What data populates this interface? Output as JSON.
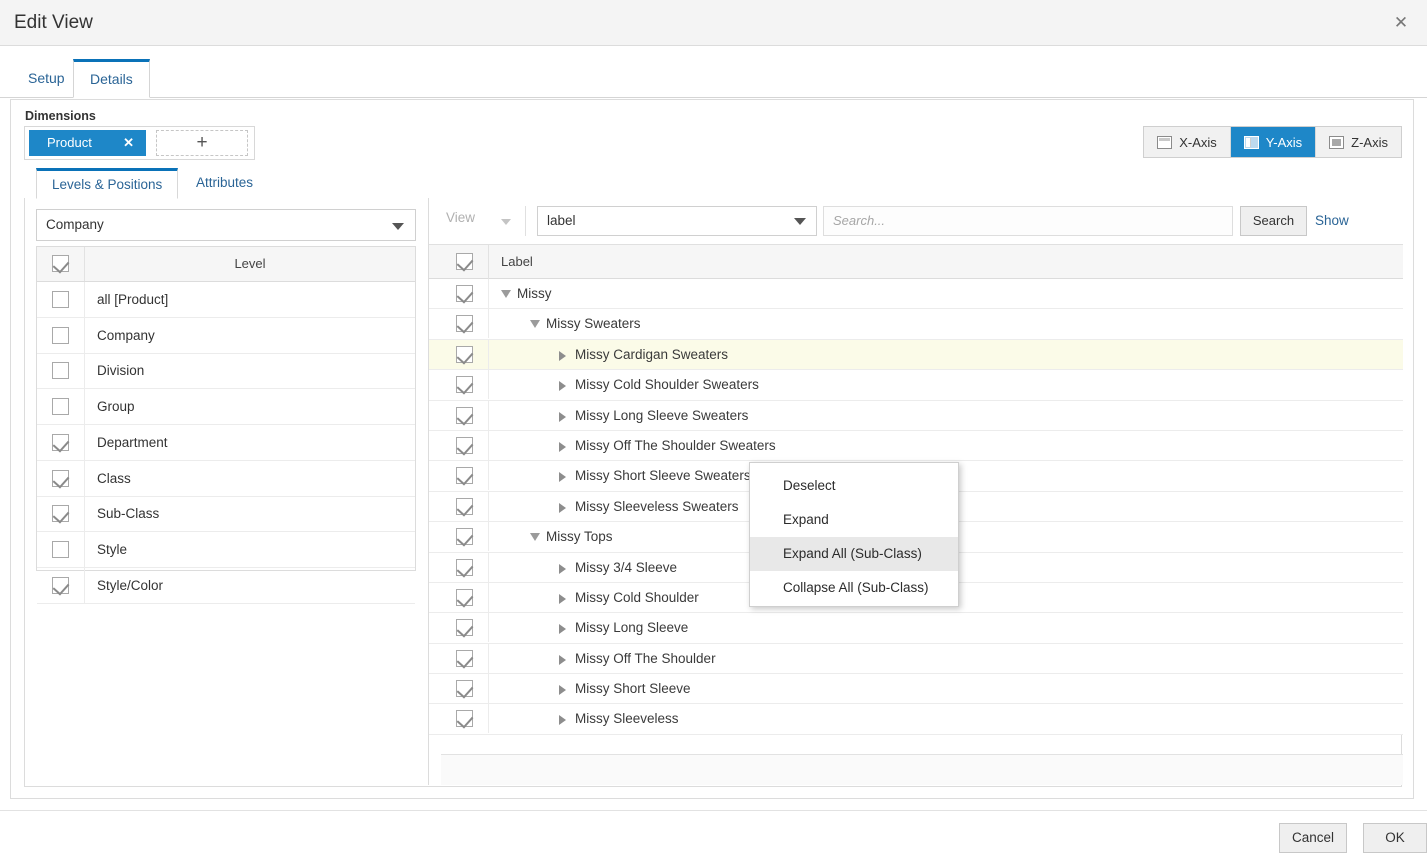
{
  "window": {
    "title": "Edit View",
    "close_icon": "close-icon"
  },
  "top_tabs": [
    {
      "label": "Setup",
      "active": false
    },
    {
      "label": "Details",
      "active": true
    }
  ],
  "dimensions": {
    "label": "Dimensions",
    "chips": [
      {
        "label": "Product",
        "remove_icon": "✕"
      }
    ],
    "add_icon": "+",
    "accent_color": "#1e87c8"
  },
  "axis_toggle": {
    "selected": "Y-Axis",
    "buttons": [
      {
        "label": "X-Axis",
        "icon": "x-axis-icon"
      },
      {
        "label": "Y-Axis",
        "icon": "y-axis-icon"
      },
      {
        "label": "Z-Axis",
        "icon": "z-axis-icon"
      }
    ]
  },
  "sub_tabs": [
    {
      "label": "Levels & Positions",
      "active": true
    },
    {
      "label": "Attributes",
      "active": false
    }
  ],
  "levels_panel": {
    "hierarchy_value": "Company",
    "column_header": "Level",
    "header_checked": true,
    "rows": [
      {
        "label": "all [Product]",
        "checked": false
      },
      {
        "label": "Company",
        "checked": false
      },
      {
        "label": "Division",
        "checked": false
      },
      {
        "label": "Group",
        "checked": false
      },
      {
        "label": "Department",
        "checked": true
      },
      {
        "label": "Class",
        "checked": true
      },
      {
        "label": "Sub-Class",
        "checked": true
      },
      {
        "label": "Style",
        "checked": false
      },
      {
        "label": "Style/Color",
        "checked": true
      }
    ]
  },
  "tree_panel": {
    "view_button": "View",
    "label_select_value": "label",
    "search_placeholder": "Search...",
    "search_value": "",
    "search_button": "Search",
    "show_selected_link": "Show Selected",
    "column_header": "Label",
    "header_checked": true,
    "rows": [
      {
        "label": "Missy",
        "checked": true,
        "depth": 0,
        "state": "expanded",
        "highlight": false
      },
      {
        "label": "Missy Sweaters",
        "checked": true,
        "depth": 1,
        "state": "expanded",
        "highlight": false
      },
      {
        "label": "Missy Cardigan Sweaters",
        "checked": true,
        "depth": 2,
        "state": "collapsed",
        "highlight": true
      },
      {
        "label": "Missy Cold Shoulder Sweaters",
        "checked": true,
        "depth": 2,
        "state": "collapsed",
        "highlight": false
      },
      {
        "label": "Missy Long Sleeve Sweaters",
        "checked": true,
        "depth": 2,
        "state": "collapsed",
        "highlight": false
      },
      {
        "label": "Missy Off The Shoulder Sweaters",
        "checked": true,
        "depth": 2,
        "state": "collapsed",
        "highlight": false
      },
      {
        "label": "Missy Short Sleeve Sweaters",
        "checked": true,
        "depth": 2,
        "state": "collapsed",
        "highlight": false
      },
      {
        "label": "Missy Sleeveless Sweaters",
        "checked": true,
        "depth": 2,
        "state": "collapsed",
        "highlight": false
      },
      {
        "label": "Missy Tops",
        "checked": true,
        "depth": 1,
        "state": "expanded",
        "highlight": false
      },
      {
        "label": "Missy 3/4 Sleeve",
        "checked": true,
        "depth": 2,
        "state": "collapsed",
        "highlight": false
      },
      {
        "label": "Missy Cold Shoulder",
        "checked": true,
        "depth": 2,
        "state": "collapsed",
        "highlight": false
      },
      {
        "label": "Missy Long Sleeve",
        "checked": true,
        "depth": 2,
        "state": "collapsed",
        "highlight": false
      },
      {
        "label": "Missy Off The Shoulder",
        "checked": true,
        "depth": 2,
        "state": "collapsed",
        "highlight": false
      },
      {
        "label": "Missy Short Sleeve",
        "checked": true,
        "depth": 2,
        "state": "collapsed",
        "highlight": false
      },
      {
        "label": "Missy Sleeveless",
        "checked": true,
        "depth": 2,
        "state": "collapsed",
        "highlight": false
      }
    ]
  },
  "context_menu": {
    "items": [
      {
        "label": "Deselect",
        "hover": false
      },
      {
        "label": "Expand",
        "hover": false
      },
      {
        "label": "Expand All (Sub-Class)",
        "hover": true
      },
      {
        "label": "Collapse All (Sub-Class)",
        "hover": false
      }
    ]
  },
  "footer": {
    "cancel_label": "Cancel",
    "ok_label": "OK"
  }
}
